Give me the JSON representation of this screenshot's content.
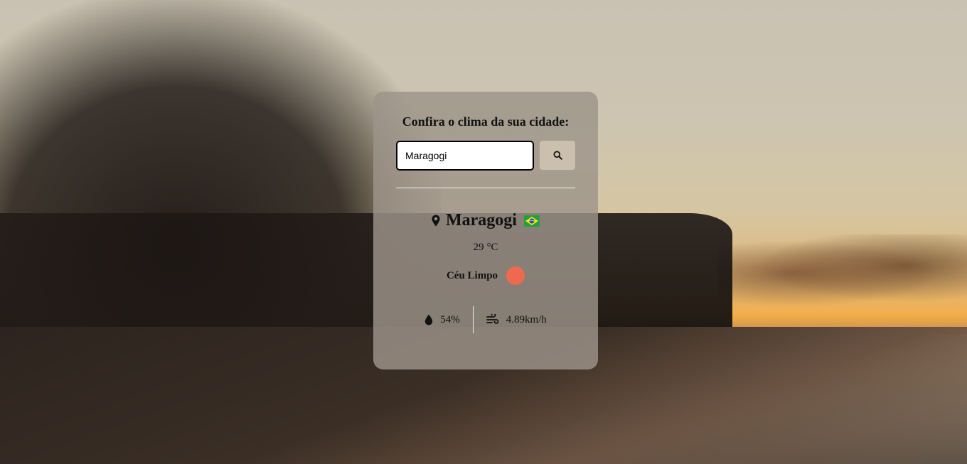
{
  "background": {
    "description_icon": "beach-sunset-background"
  },
  "card": {
    "title": "Confira o clima da sua cidade:",
    "search": {
      "value": "Maragogi",
      "placeholder": "",
      "button_icon": "search-icon"
    },
    "result": {
      "location_icon": "map-pin-icon",
      "city": "Maragogi",
      "flag_icon": "brazil-flag-icon",
      "temperature": "29",
      "unit": "°C",
      "description": "Céu Limpo",
      "weather_icon": "sun-icon",
      "humidity_icon": "droplet-icon",
      "humidity": "54%",
      "wind_icon": "wind-icon",
      "wind": "4.89km/h"
    }
  },
  "colors": {
    "card_bg": "#9e948a",
    "search_button_bg": "#cbc0ad",
    "weather_icon": "#ed6a51"
  }
}
